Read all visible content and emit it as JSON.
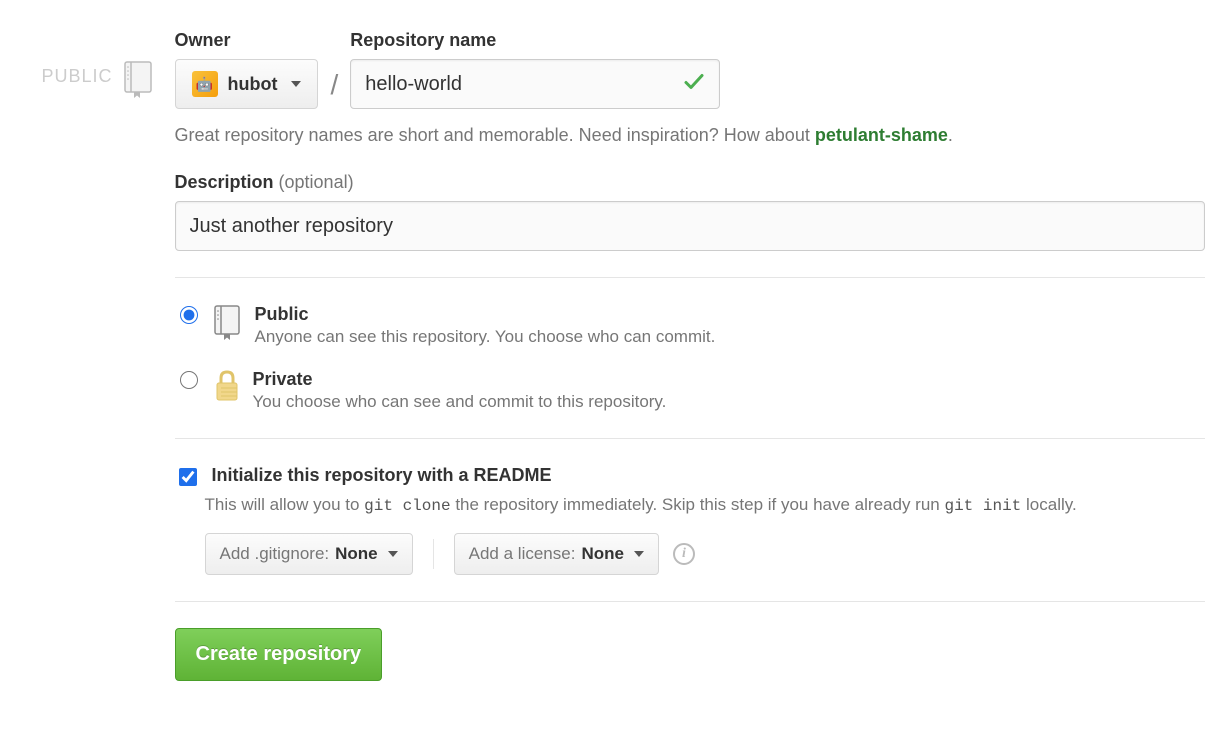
{
  "sidebar": {
    "public_label": "PUBLIC"
  },
  "form": {
    "owner_label": "Owner",
    "owner_value": "hubot",
    "repo_label": "Repository name",
    "repo_value": "hello-world",
    "hint_pre": "Great repository names are short and memorable. Need inspiration? How about ",
    "hint_suggestion": "petulant-shame",
    "hint_post": ".",
    "description_label_strong": "Description",
    "description_label_muted": " (optional)",
    "description_value": "Just another repository"
  },
  "visibility": {
    "public": {
      "title": "Public",
      "sub": "Anyone can see this repository. You choose who can commit.",
      "selected": true
    },
    "private": {
      "title": "Private",
      "sub": "You choose who can see and commit to this repository."
    }
  },
  "readme": {
    "label": "Initialize this repository with a README",
    "checked": true,
    "sub_pre": "This will allow you to ",
    "sub_code1": "git clone",
    "sub_mid": " the repository immediately. Skip this step if you have already run ",
    "sub_code2": "git init",
    "sub_post": " locally."
  },
  "dropdowns": {
    "gitignore_label": "Add .gitignore: ",
    "gitignore_value": "None",
    "license_label": "Add a license: ",
    "license_value": "None"
  },
  "actions": {
    "create_label": "Create repository"
  }
}
